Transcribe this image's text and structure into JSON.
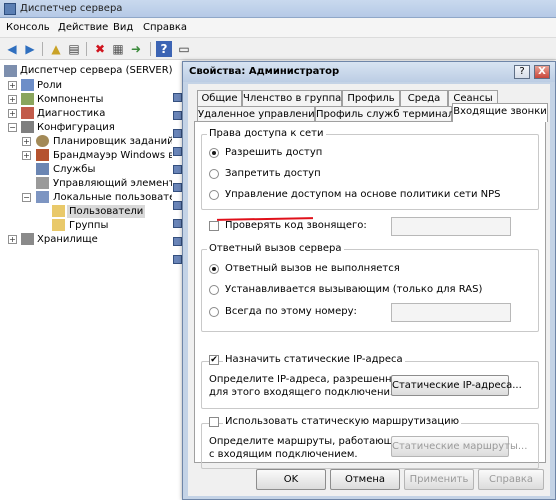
{
  "window": {
    "title": "Диспетчер сервера"
  },
  "menu": [
    "Консоль",
    "Действие",
    "Вид",
    "Справка"
  ],
  "tree": {
    "root": "Диспетчер сервера (SERVER)",
    "roles": "Роли",
    "components": "Компоненты",
    "diagnostics": "Диагностика",
    "configuration": "Конфигурация",
    "scheduler": "Планировщик заданий",
    "firewall": "Брандмауэр Windows в ре",
    "services": "Службы",
    "wmi": "Управляющий элемент W",
    "local_users": "Локальные пользователи",
    "users": "Пользователи",
    "groups": "Группы",
    "storage": "Хранилище"
  },
  "dialog": {
    "title": "Свойства: Администратор",
    "help": "?",
    "close": "X",
    "tabs_row1": [
      "Общие",
      "Членство в группах",
      "Профиль",
      "Среда",
      "Сеансы"
    ],
    "tabs_row2": [
      "Удаленное управление",
      "Профиль служб терминалов",
      "Входящие звонки"
    ],
    "network_access": {
      "label": "Права доступа к сети",
      "allow": "Разрешить доступ",
      "deny": "Запретить доступ",
      "nps": "Управление доступом на основе политики сети NPS",
      "selected": "allow"
    },
    "verify_caller": {
      "label": "Проверять код звонящего:",
      "checked": false
    },
    "callback": {
      "label": "Ответный вызов сервера",
      "none": "Ответный вызов не выполняется",
      "caller": "Устанавливается вызывающим (только для RAS)",
      "always": "Всегда по этому номеру:",
      "selected": "none"
    },
    "static_ip": {
      "label": "Назначить статические IP-адреса",
      "checked": true,
      "desc1": "Определите IP-адреса, разрешенные",
      "desc2": "для этого входящего подключения.",
      "button": "Статические IP-адреса..."
    },
    "static_routes": {
      "label": "Использовать статическую маршрутизацию",
      "checked": false,
      "desc1": "Определите маршруты, работающие",
      "desc2": "с входящим подключением.",
      "button": "Статические маршруты..."
    },
    "buttons": {
      "ok": "OK",
      "cancel": "Отмена",
      "apply": "Применить",
      "help": "Справка"
    }
  }
}
